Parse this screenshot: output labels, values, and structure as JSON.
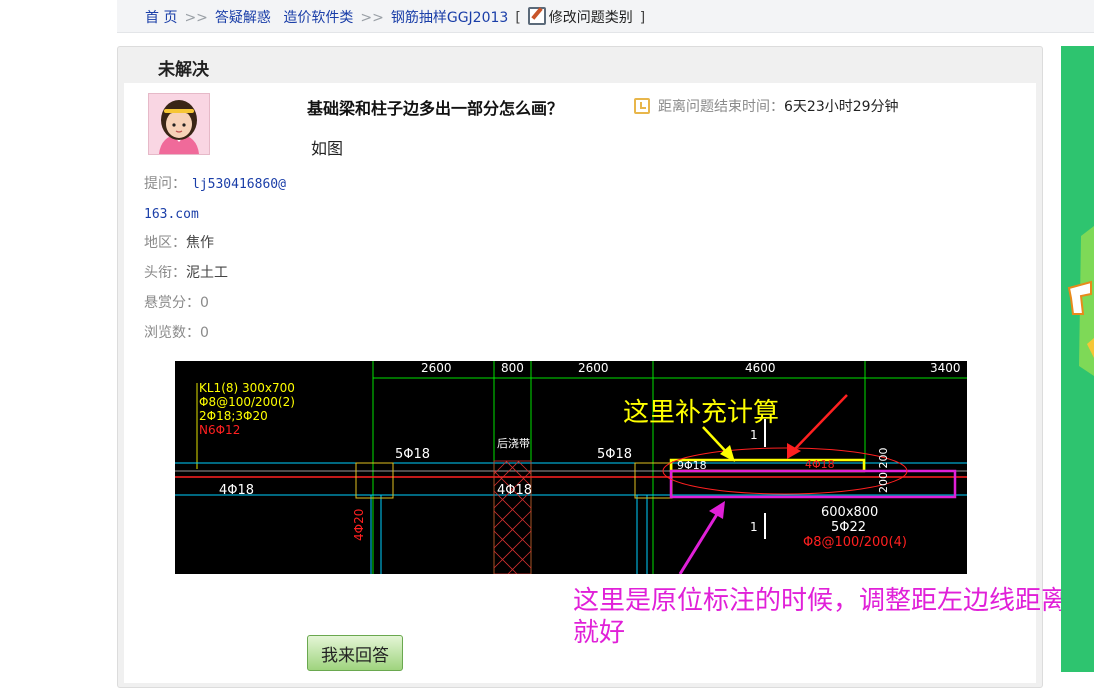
{
  "breadcrumb": {
    "home": "首 页",
    "sep": ">>",
    "items": [
      "答疑解惑",
      "造价软件类",
      "钢筋抽样GGJ2013"
    ],
    "bracket_open": "[",
    "edit_label": "修改问题类别",
    "bracket_close": "]"
  },
  "status": "未解决",
  "question": {
    "title": "基础梁和柱子边多出一部分怎么画？",
    "timer_label": "距离问题结束时间：",
    "timer_value": "6天23小时29分钟",
    "body": "如图"
  },
  "asker": {
    "label": "提问：",
    "name_line1": "lj530416860@",
    "name_line2": "163.com",
    "region_label": "地区：",
    "region": "焦作",
    "title_label": "头衔：",
    "title": "泥土工",
    "reward_label": "悬赏分：",
    "reward": "0",
    "views_label": "浏览数：",
    "views": "0"
  },
  "drawing": {
    "dims": [
      "2600",
      "800",
      "2600",
      "4600",
      "3400"
    ],
    "beam_lines": [
      "KL1(8) 300x700",
      "Φ8@100/200(2)",
      "2Φ18;3Φ20",
      "N6Φ12"
    ],
    "label_5b18_a": "5Φ18",
    "label_5b18_b": "5Φ18",
    "label_4b18_a": "4Φ18",
    "label_4b18_b": "4Φ18",
    "label_4b20": "4Φ20",
    "label_houjiao": "后浇带",
    "label_9b18": "9Φ18",
    "label_4b18_red": "4Φ18",
    "label_200_200": "200 200",
    "label_1_top": "1",
    "label_1_bottom": "1",
    "section_size": "600x800",
    "section_bars": "5Φ22",
    "section_stirrup": "Φ8@100/200(4)",
    "yellow_note": "这里补充计算"
  },
  "answer_button": "我来回答",
  "callout": "这里是原位标注的时候，调整距左边线距离就好",
  "colors": {
    "link": "#1a3ea8",
    "green_button": "#9fd47e",
    "annotation_magenta": "#e020d8",
    "annotation_yellow": "#ffff00",
    "cad_green": "#00e000",
    "cad_red": "#ff2020",
    "cad_cyan": "#00d0ff"
  },
  "icons": [
    "edit-icon",
    "clock-icon",
    "avatar"
  ]
}
